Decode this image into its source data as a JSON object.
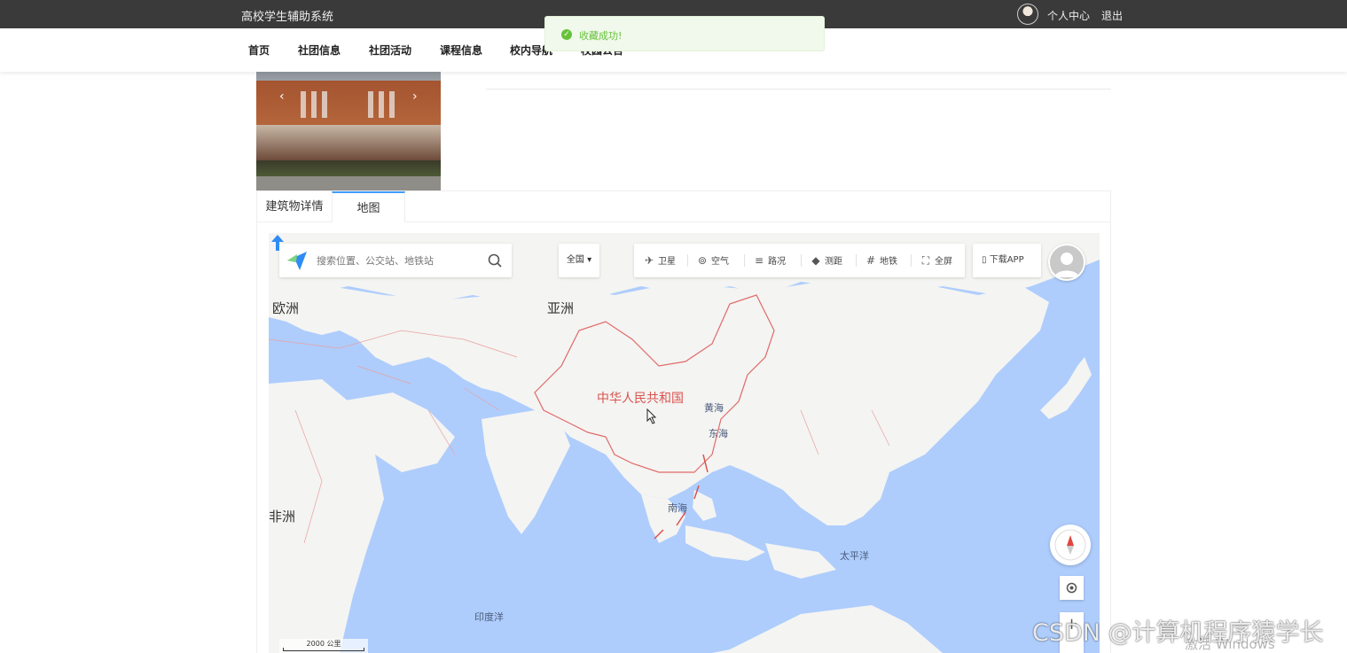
{
  "header": {
    "site_title": "高校学生辅助系统",
    "user_center": "个人中心",
    "logout": "退出"
  },
  "nav": {
    "items": [
      {
        "label": "首页"
      },
      {
        "label": "社团信息"
      },
      {
        "label": "社团活动"
      },
      {
        "label": "课程信息"
      },
      {
        "label": "校内导航"
      },
      {
        "label": "校园公告"
      }
    ]
  },
  "toast": {
    "message": "收藏成功!",
    "type": "success"
  },
  "detail_tabs": {
    "items": [
      {
        "label": "建筑物详情"
      },
      {
        "label": "地图"
      }
    ],
    "active": "地图"
  },
  "map": {
    "search_placeholder": "搜索位置、公交站、地铁站",
    "region_select": "全国",
    "tools": [
      {
        "label": "卫星",
        "icon": "satellite-icon"
      },
      {
        "label": "空气",
        "icon": "air-icon"
      },
      {
        "label": "路况",
        "icon": "traffic-icon"
      },
      {
        "label": "测距",
        "icon": "ruler-icon"
      },
      {
        "label": "地铁",
        "icon": "subway-icon"
      },
      {
        "label": "全屏",
        "icon": "fullscreen-icon"
      }
    ],
    "download_app": "下载APP",
    "labels": {
      "europe": "欧洲",
      "asia": "亚洲",
      "africa": "非洲",
      "china": "中华人民共和国",
      "yellow_sea": "黄海",
      "east_sea": "东海",
      "south_sea": "南海",
      "pacific": "太平洋",
      "indian_ocean": "印度洋"
    },
    "scale": "2000 公里",
    "zoom_in": "+",
    "colors": {
      "water": "#aecdfd",
      "land": "#f4f4f2",
      "border": "#e08a8a"
    }
  },
  "watermark": "CSDN @计算机程序猿学长",
  "os_notice": "激活 Windows"
}
